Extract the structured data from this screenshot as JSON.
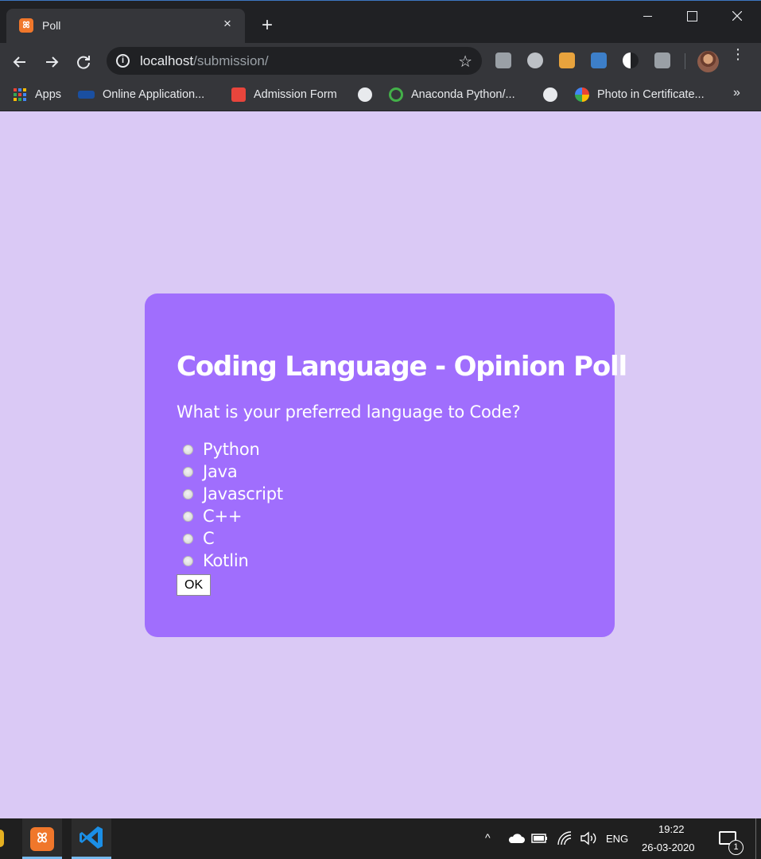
{
  "browser": {
    "tab": {
      "title": "Poll",
      "favicon": "xampp-icon",
      "close": "×"
    },
    "new_tab": "+",
    "url": {
      "host": "localhost",
      "path": "/submission/"
    },
    "star": "☆",
    "info": "i",
    "more": "⋮"
  },
  "bookmarks": [
    {
      "label": "Apps",
      "icon": "apps-grid-icon"
    },
    {
      "label": "Online Application...",
      "icon": "sap-icon"
    },
    {
      "label": "Admission Form",
      "icon": "lightbulb-icon"
    },
    {
      "label": "",
      "icon": "globe-icon"
    },
    {
      "label": "Anaconda Python/...",
      "icon": "anaconda-icon"
    },
    {
      "label": "",
      "icon": "globe-icon"
    },
    {
      "label": "Photo in Certificate...",
      "icon": "pinwheel-icon"
    }
  ],
  "bookmarks_more": "»",
  "poll": {
    "title": "Coding Language - Opinion Poll",
    "question": "What is your preferred language to Code?",
    "options": [
      "Python",
      "Java",
      "Javascript",
      "C++",
      "C",
      "Kotlin"
    ],
    "submit_label": "OK"
  },
  "taskbar": {
    "apps": [
      "xampp-icon",
      "vscode-icon"
    ],
    "xampp_glyph": "ꕤ",
    "language": "ENG",
    "time": "19:22",
    "date": "26-03-2020",
    "notification_count": "1",
    "chevron": "^"
  },
  "colors": {
    "page_background": "#dac9f5",
    "card_background": "#a06efd",
    "chrome_dark": "#202124",
    "chrome_toolbar": "#35363a"
  }
}
